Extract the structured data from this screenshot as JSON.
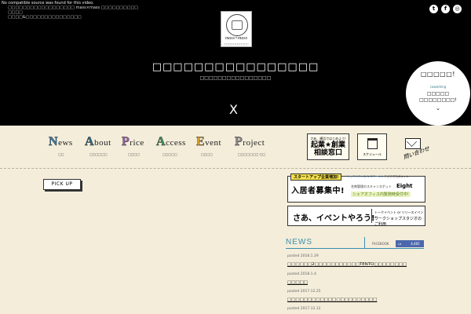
{
  "hero": {
    "video_message": "No compatible source was found for this video.",
    "tagline_1": "□□□□□□□□□□□□□□□□□□ mass×mass □□□□□□□□□□",
    "tagline_2": "□□□□",
    "tagline_3": "□□□□&□□□□□□□□□□□□□□□",
    "logo_text": "mass×mass",
    "logo_sub": "□□□□□□□□□□□",
    "title": "□□□□□□□□□□□□□□□□",
    "subtitle": "□□□□□□□□□□□□□□□□",
    "close_label": "X",
    "social": {
      "twitter": "t",
      "facebook": "f",
      "instagram": "◎"
    },
    "badge": {
      "top": "□□□□□!",
      "middle": "coworking",
      "bottom_1": "□□□□□",
      "bottom_2": "□□□□□□□□!",
      "chevron": "⌄"
    }
  },
  "nav": {
    "items": [
      {
        "cap": "N",
        "rest": "ews",
        "sub": "□□"
      },
      {
        "cap": "A",
        "rest": "bout",
        "sub": "□□□□□□"
      },
      {
        "cap": "P",
        "rest": "rice",
        "sub": "□□□□"
      },
      {
        "cap": "A",
        "rest": "ccess",
        "sub": "□□□□□"
      },
      {
        "cap": "E",
        "rest": "vent",
        "sub": "□□□□"
      },
      {
        "cap": "P",
        "rest": "roject",
        "sub": "□□□□□□□·□□"
      }
    ],
    "business_box": {
      "line1": "さあ、横浜ではじめよう!",
      "line2": "起業★創業",
      "line3": "相談窓口"
    },
    "schedule_label": "スケジュール",
    "contact_label": "問い合わせ"
  },
  "pickup_label": "PICK UP",
  "banners": {
    "recruit": {
      "tag": "スタートアップ企業増加!",
      "share": "シェアオフィス\n& コワーキング",
      "scan": "どこでもスキャン",
      "main": "入居者募集中!",
      "right": "名刺管理のスキャンスポット",
      "eight": "Eight",
      "bottom": "シェアオフィス内覧随時受付中!"
    },
    "event": {
      "main": "さあ、イベントやろう!",
      "right1": "トークイベント or リリースイベント",
      "right2": "ワークショップスタジオのご利用"
    }
  },
  "news": {
    "heading": "NEWS",
    "facebook_label": "FACEBOOK",
    "like_count": "4,485",
    "items": [
      {
        "date": "posted 2018.1.29",
        "title": "□□□□□□2□□□□□□□□□□□TENTO□□□□□□□□"
      },
      {
        "date": "posted 2018.1.4",
        "title": "□□□□□"
      },
      {
        "date": "posted 2017.12.25",
        "title": "□□□□□□□□□□□□□□□□□□□□□□"
      },
      {
        "date": "posted 2017.12.12",
        "title": "□□□□□□□□□□□□□□□□□□□□"
      }
    ]
  }
}
